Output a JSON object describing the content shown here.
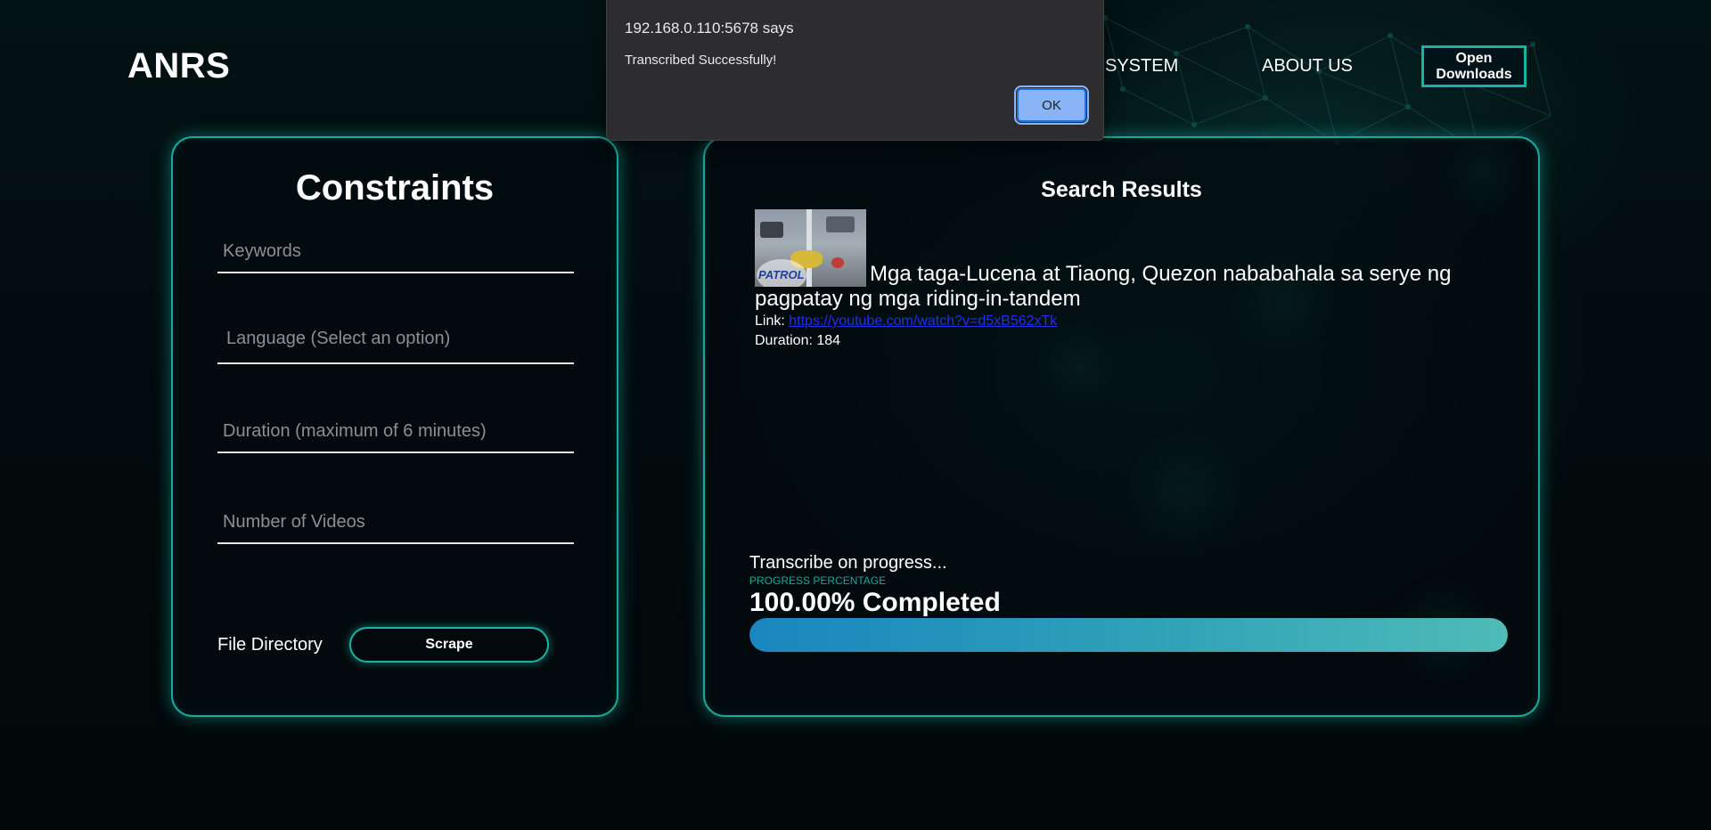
{
  "header": {
    "logo": "ANRS",
    "nav": {
      "system_label": "SYSTEM",
      "about_label": "ABOUT US"
    },
    "open_downloads_label": "Open Downloads"
  },
  "constraints": {
    "title": "Constraints",
    "keywords_placeholder": "Keywords",
    "language_placeholder": "Language (Select an option)",
    "duration_placeholder": "Duration (maximum of 6 minutes)",
    "videos_placeholder": "Number of Videos",
    "file_directory_label": "File Directory",
    "scrape_label": "Scrape"
  },
  "results": {
    "title": "Search Results",
    "items": [
      {
        "title": "Mga taga-Lucena at Tiaong, Quezon nababahala sa serye ng pagpatay ng mga riding-in-tandem",
        "link_label": "Link: ",
        "link_url": "https://youtube.com/watch?v=d5xB562xTk",
        "duration_label": "Duration: ",
        "duration": "184",
        "thumbnail_logo": "PATROL"
      }
    ],
    "progress": {
      "status": "Transcribe on progress...",
      "caption": "PROGRESS PERCENTAGE",
      "value_text": "100.00% Completed",
      "fraction": 1.0
    }
  },
  "dialog": {
    "origin": "192.168.0.110:5678 says",
    "message": "Transcribed Successfully!",
    "ok_label": "OK"
  },
  "colors": {
    "accent": "#18a99c",
    "progress_start": "#1a86bf",
    "progress_end": "#4fbcb8",
    "dialog_button": "#8ab4f8"
  }
}
